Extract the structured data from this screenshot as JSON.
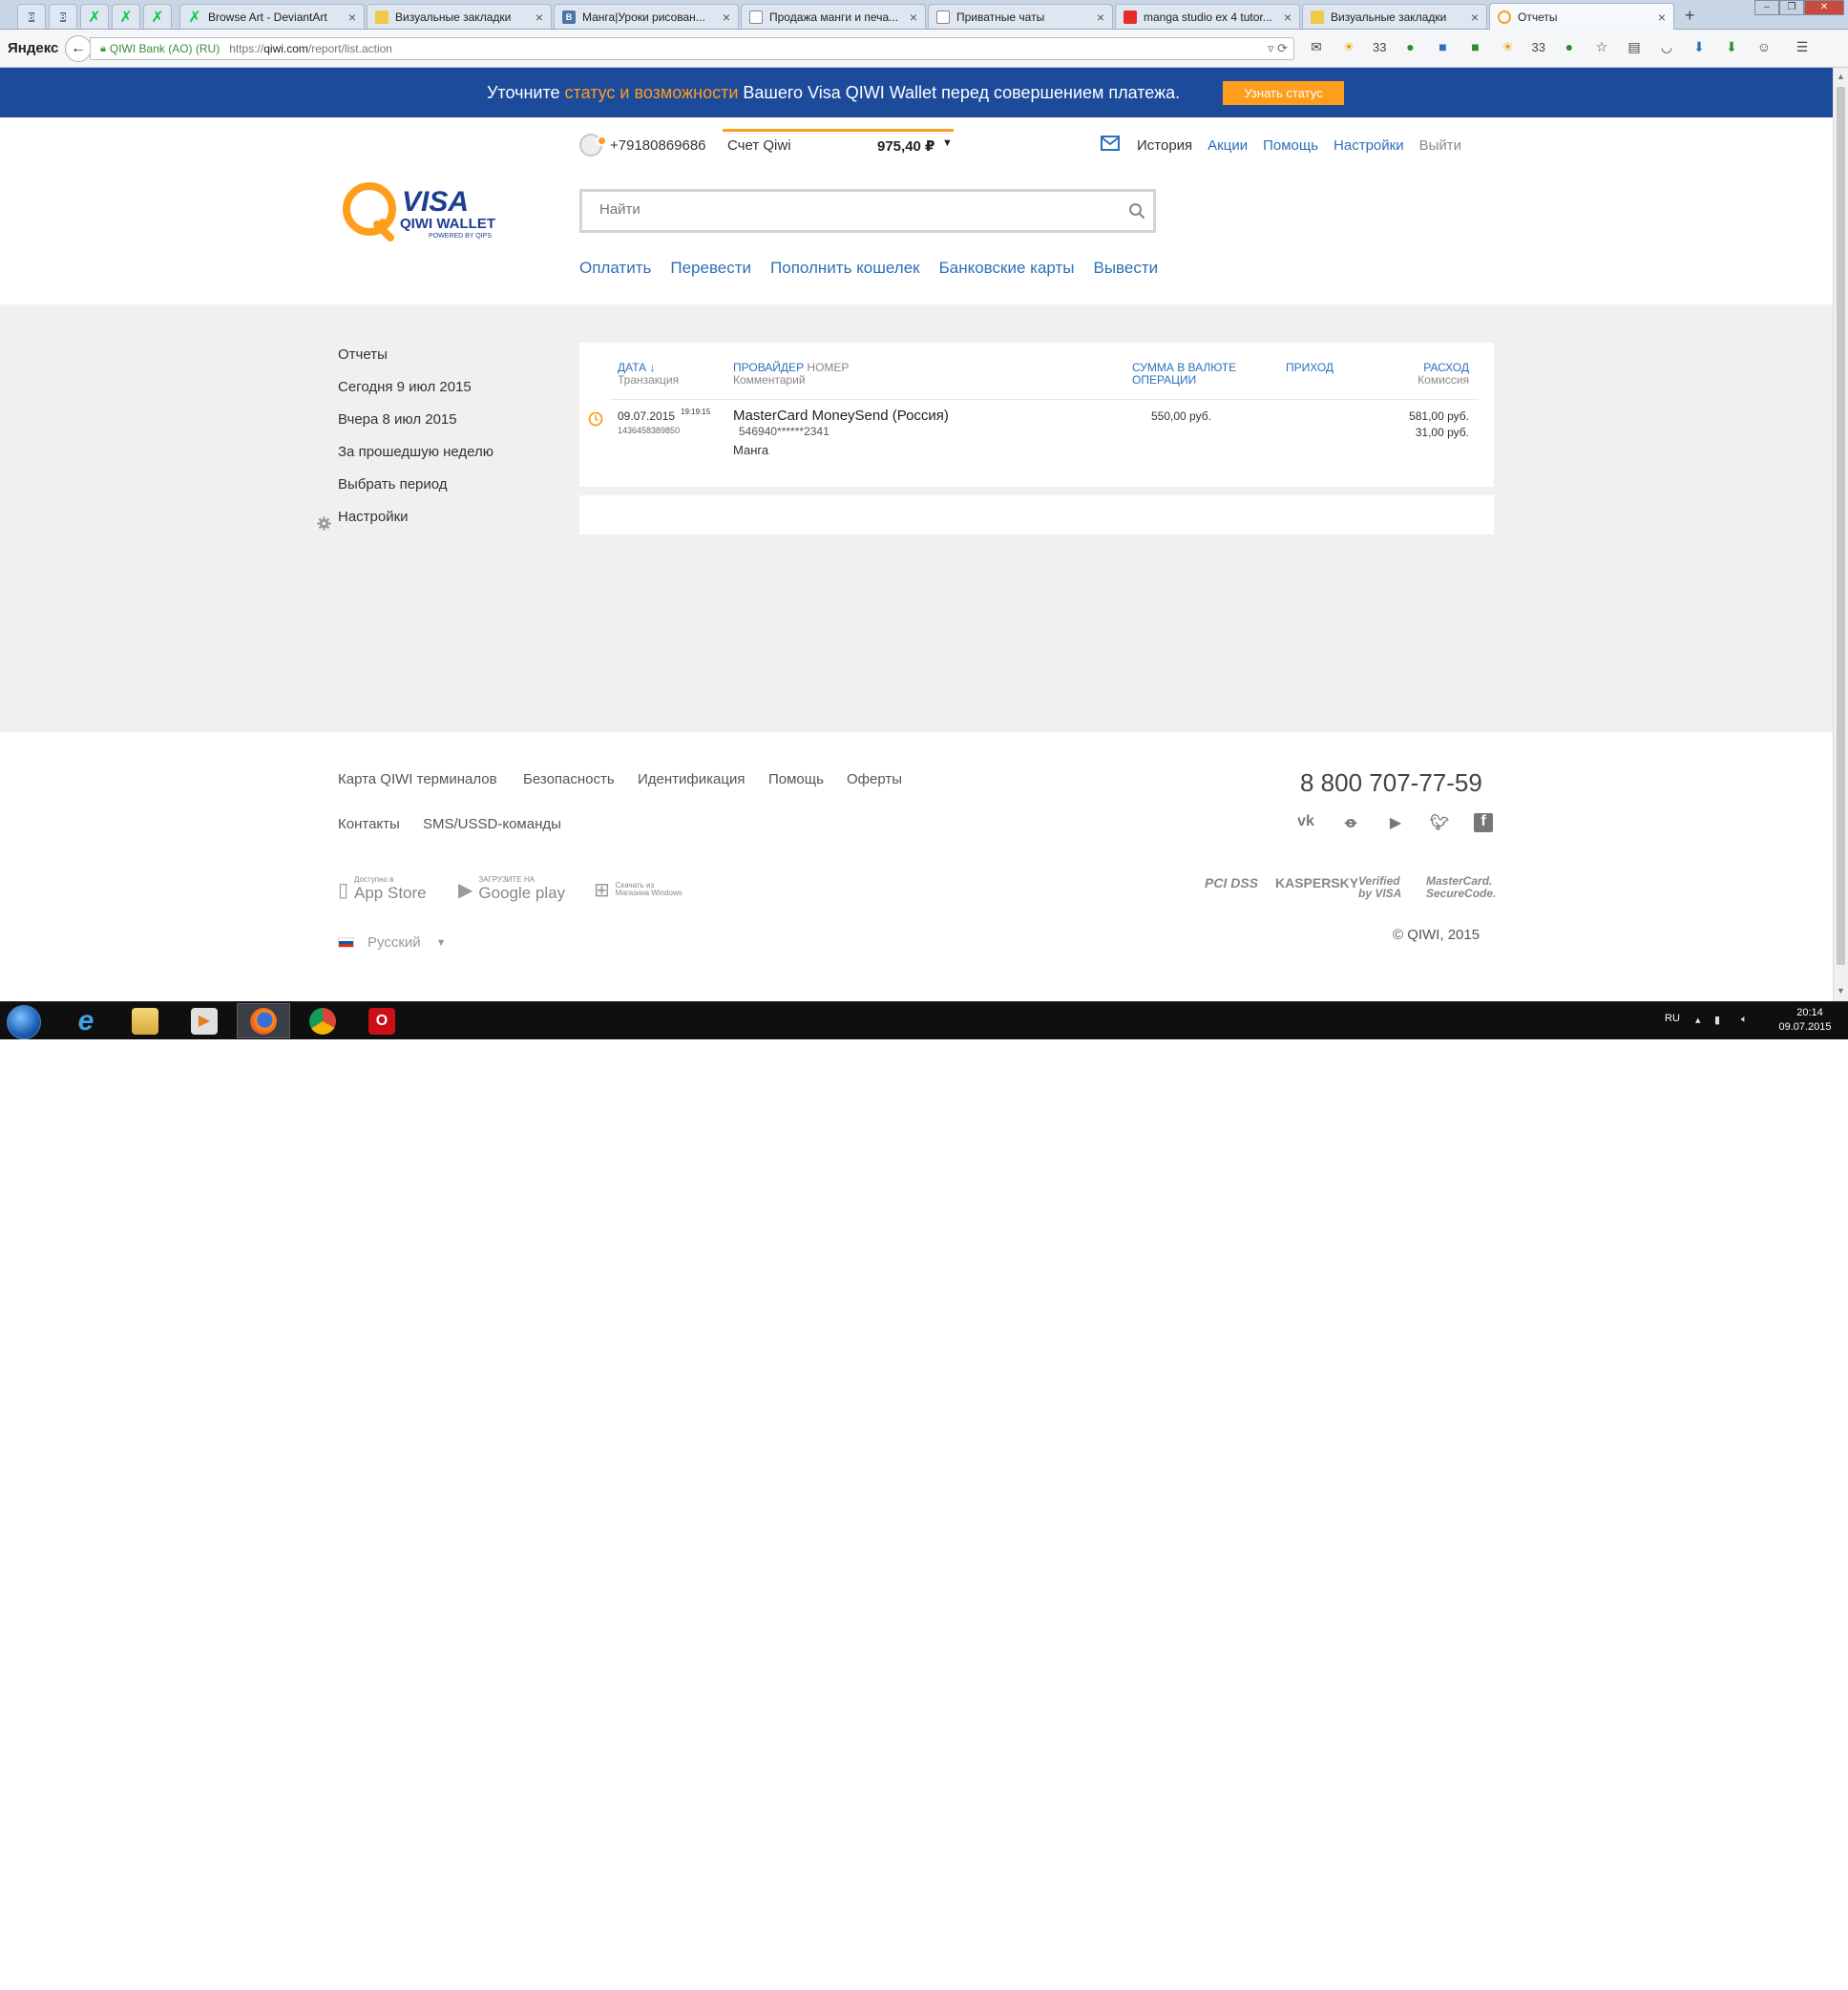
{
  "browser": {
    "pinned_tabs": [
      {
        "icon": "vk-icon",
        "label": "В"
      },
      {
        "icon": "vk-icon",
        "label": "В"
      },
      {
        "icon": "deviantart-icon",
        "label": "✗"
      },
      {
        "icon": "deviantart-icon",
        "label": "✗"
      },
      {
        "icon": "deviantart-icon",
        "label": "✗"
      }
    ],
    "tabs": [
      {
        "label": "Browse Art - DeviantArt",
        "icon": "deviantart-icon"
      },
      {
        "label": "Визуальные закладки",
        "icon": "bookmarks-icon"
      },
      {
        "label": "Манга|Уроки рисован...",
        "icon": "vk-icon"
      },
      {
        "label": "Продажа манги и печа...",
        "icon": "page-icon"
      },
      {
        "label": "Приватные чаты",
        "icon": "page-icon"
      },
      {
        "label": "manga studio ex 4 tutor...",
        "icon": "youtube-icon"
      },
      {
        "label": "Визуальные закладки",
        "icon": "bookmarks-icon"
      },
      {
        "label": "Отчеты",
        "icon": "qiwi-icon",
        "active": true
      }
    ],
    "new_tab": "+",
    "close_glyph": "×",
    "yandex_logo": "Яндекс",
    "site_identity": "QIWI Bank (AO) (RU)",
    "url_prefix": "https://",
    "url_host": "qiwi.com",
    "url_path": "/report/list.action",
    "toolbar_badges": {
      "weather1": "33",
      "weather2": "33"
    }
  },
  "banner": {
    "text_before": "Уточните ",
    "text_highlight": "статус и возможности",
    "text_after": " Вашего Visa QIWI Wallet перед совершением платежа.",
    "button": "Узнать статус"
  },
  "header": {
    "logo_alt": "VISA QIWI WALLET",
    "logo_visa": "VISA",
    "logo_qiwi": "QIWI WALLET",
    "logo_powered": "POWERED BY QIPS",
    "phone": "+79180869686",
    "account_label": "Счет Qiwi",
    "balance": "975,40 ₽",
    "balance_arrow": "▼",
    "links": {
      "history": "История",
      "promo": "Акции",
      "help": "Помощь",
      "settings": "Настройки",
      "logout": "Выйти"
    },
    "search_placeholder": "Найти",
    "nav": [
      "Оплатить",
      "Перевести",
      "Пополнить кошелек",
      "Банковские карты",
      "Вывести"
    ]
  },
  "sidebar": {
    "items": [
      "Отчеты",
      "Сегодня 9 июл 2015",
      "Вчера 8 июл 2015",
      "За прошедшую неделю",
      "Выбрать период",
      "Настройки"
    ]
  },
  "report": {
    "headers": {
      "date": "ДАТА ↓",
      "transaction": "Транзакция",
      "provider": "ПРОВАЙДЕР",
      "number": "НОМЕР",
      "comment": "Комментарий",
      "amount_line1": "СУММА В ВАЛЮТЕ",
      "amount_line2": "ОПЕРАЦИИ",
      "income": "ПРИХОД",
      "expense": "РАСХОД",
      "commission": "Комиссия"
    },
    "rows": [
      {
        "date": "09.07.2015",
        "time": "19:19:15",
        "transaction_id": "1436458389850",
        "provider": "MasterCard MoneySend (Россия)",
        "number": "546940******2341",
        "comment": "Манга",
        "amount": "550,00 руб.",
        "income": "",
        "expense": "581,00 руб.",
        "commission": "31,00 руб."
      }
    ]
  },
  "footer": {
    "links_row1": [
      "Карта QIWI терминалов",
      "Безопасность",
      "Идентификация",
      "Помощь",
      "Оферты"
    ],
    "links_row2": [
      "Контакты",
      "SMS/USSD-команды"
    ],
    "hotline": "8 800 707-77-59",
    "social": [
      "vk-icon",
      "odnoklassniki-icon",
      "youtube-icon",
      "twitter-icon",
      "facebook-icon"
    ],
    "stores": {
      "appstore_sub": "Доступно в",
      "appstore": "App Store",
      "googleplay_sub": "ЗАГРУЗИТЕ НА",
      "googleplay": "Google play",
      "windows_sub": "Скачать из",
      "windows": "Магазина Windows"
    },
    "certs": {
      "pci": "PCI DSS",
      "kaspersky": "KASPERSKY",
      "visa": "Verified by VISA",
      "mastercard": "MasterCard. SecureCode."
    },
    "copyright": "© QIWI, 2015",
    "language": "Русский",
    "language_arrow": "▼"
  },
  "taskbar": {
    "lang": "RU",
    "time": "20:14",
    "date": "09.07.2015"
  },
  "colors": {
    "brand_blue": "#1d4b9b",
    "accent_orange": "#ff9d1c",
    "link_blue": "#2d6fba"
  }
}
